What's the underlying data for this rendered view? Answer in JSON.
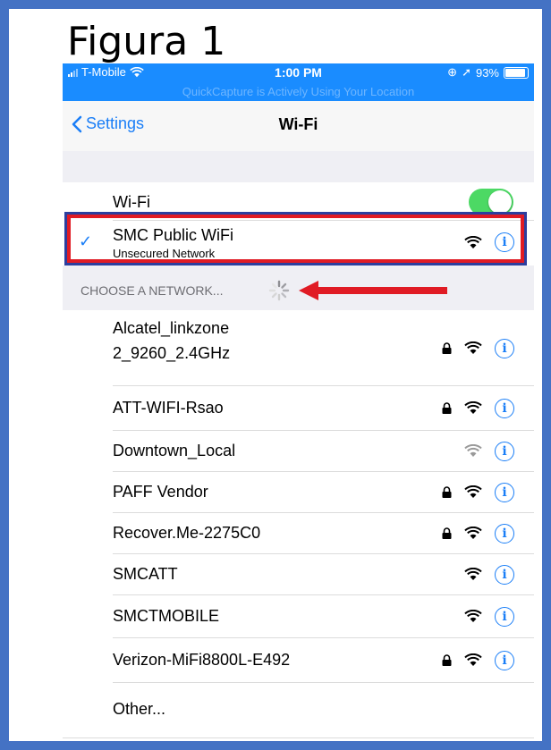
{
  "slide": {
    "title": "Figura 1"
  },
  "status_bar": {
    "carrier": "T-Mobile",
    "time": "1:00 PM",
    "battery": "93%",
    "banner": "QuickCapture is Actively Using Your Location"
  },
  "nav": {
    "back_label": "Settings",
    "title": "Wi-Fi"
  },
  "wifi_toggle": {
    "label": "Wi-Fi",
    "state": "on"
  },
  "connected": {
    "name": "SMC Public WiFi",
    "subtitle": "Unsecured Network"
  },
  "section_header": "CHOOSE A NETWORK...",
  "networks": [
    {
      "line1": "Alcatel_linkzone",
      "line2": "2_9260_2.4GHz",
      "locked": true
    },
    {
      "line1": "ATT-WIFI-Rsao",
      "locked": true
    },
    {
      "line1": "Downtown_Local",
      "locked": false,
      "weak": true
    },
    {
      "line1": "PAFF Vendor",
      "locked": true
    },
    {
      "line1": "Recover.Me-2275C0",
      "locked": true
    },
    {
      "line1": "SMCATT",
      "locked": false
    },
    {
      "line1": "SMCTMOBILE",
      "locked": false
    },
    {
      "line1": "Verizon-MiFi8800L-E492",
      "locked": true
    }
  ],
  "other_label": "Other...",
  "icons": {
    "info": "i",
    "check": "✓",
    "back": "‹"
  },
  "colors": {
    "accent": "#1a7ef7",
    "status_bar": "#1a8cff",
    "toggle_on": "#4cd964",
    "highlight": "#e01b24",
    "frame": "#4472c4"
  }
}
